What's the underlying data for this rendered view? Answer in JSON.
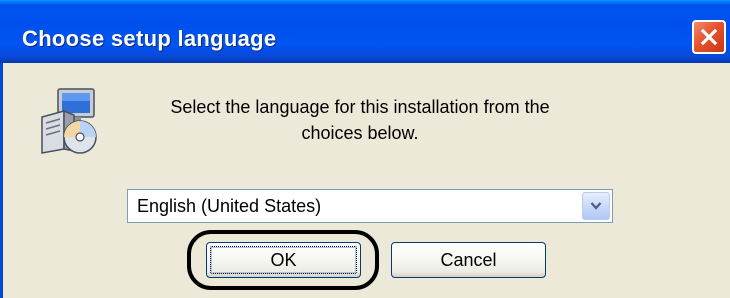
{
  "window": {
    "title": "Choose setup language",
    "close_icon": "close-icon"
  },
  "content": {
    "icon": "setup-installer-icon",
    "message": "Select the language for this installation from the choices below.",
    "language_select": {
      "selected": "English (United States)",
      "arrow_icon": "chevron-down-icon"
    }
  },
  "buttons": {
    "ok_label": "OK",
    "cancel_label": "Cancel"
  },
  "colors": {
    "titlebar": "#0053ee",
    "dialog_bg": "#ece9d8",
    "close_button": "#e5532d",
    "annotation_ring": "#000000"
  }
}
